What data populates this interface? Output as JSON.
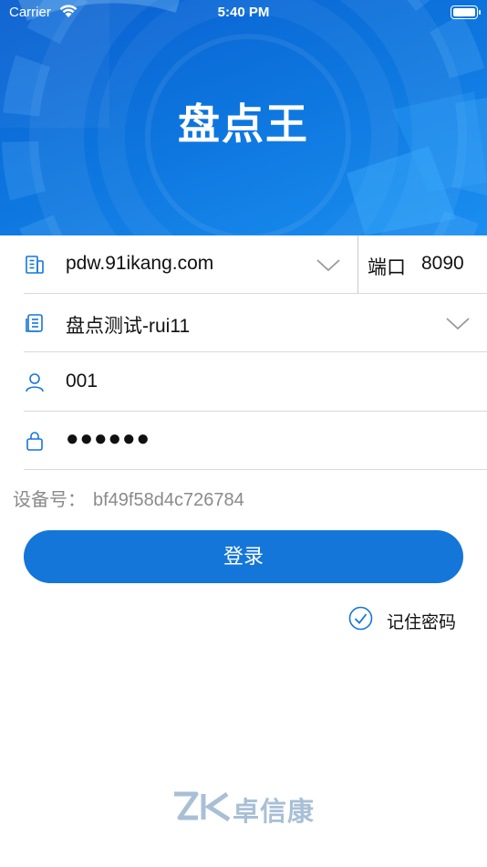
{
  "status_bar": {
    "carrier": "Carrier",
    "time": "5:40 PM"
  },
  "header": {
    "title": "盘点王"
  },
  "form": {
    "server": {
      "value": "pdw.91ikang.com",
      "icon": "building-icon"
    },
    "port": {
      "label": "端口",
      "value": "8090"
    },
    "account": {
      "value": "盘点测试-rui11",
      "icon": "document-list-icon"
    },
    "username": {
      "value": "001",
      "icon": "user-icon"
    },
    "password": {
      "value": "●●●●●●",
      "icon": "lock-icon"
    }
  },
  "device": {
    "label": "设备号：",
    "value": "bf49f58d4c726784"
  },
  "login_button": {
    "label": "登录"
  },
  "remember": {
    "label": "记住密码",
    "checked": true
  },
  "brand": {
    "logo_text": "ZK",
    "name": "卓信康"
  },
  "colors": {
    "primary": "#1476d8",
    "header": "#0d74dd",
    "muted": "#8a8a8a",
    "brand": "#a8bfd6"
  }
}
